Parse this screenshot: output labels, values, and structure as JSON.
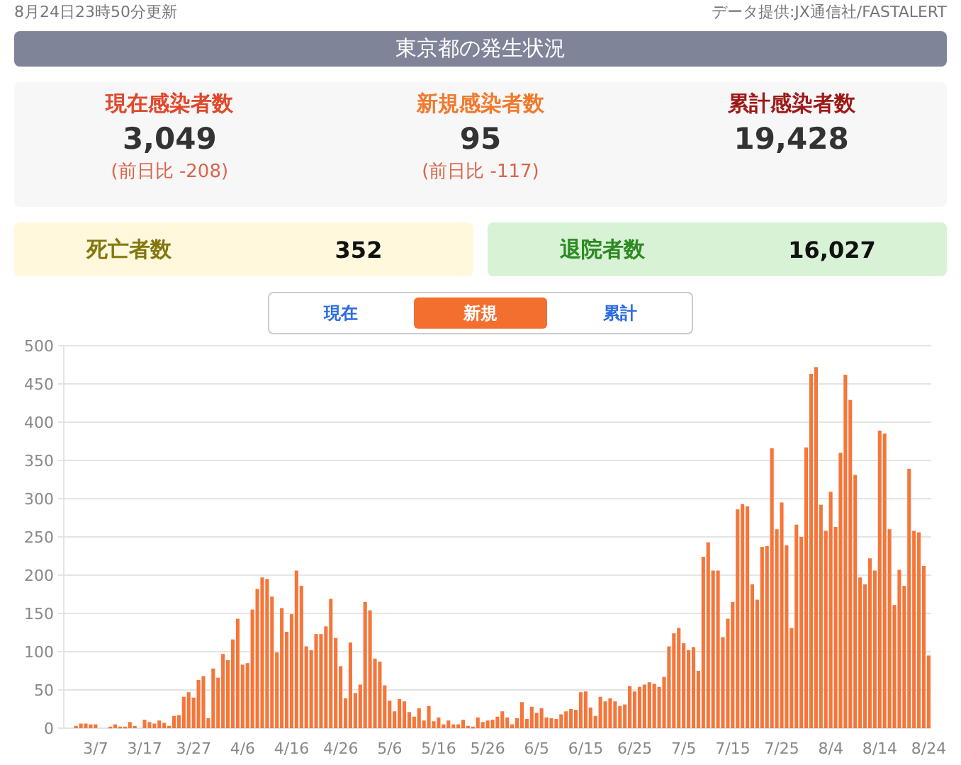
{
  "updated": "8月24日23時50分更新",
  "source": "データ提供:JX通信社/FASTALERT",
  "header": "東京都の発生状況",
  "stats": [
    {
      "label": "現在感染者数",
      "value": "3,049",
      "change": "(前日比 -208)",
      "color": "#e0482c"
    },
    {
      "label": "新規感染者数",
      "value": "95",
      "change": "(前日比 -117)",
      "color": "#f07a2e"
    },
    {
      "label": "累計感染者数",
      "value": "19,428",
      "color": "#9e1a1a"
    }
  ],
  "totals": [
    {
      "kind": "death",
      "label": "死亡者数",
      "value": "352"
    },
    {
      "kind": "recovered",
      "label": "退院者数",
      "value": "16,027"
    }
  ],
  "tabs": [
    {
      "label": "現在",
      "selected": false
    },
    {
      "label": "新規",
      "selected": true
    },
    {
      "label": "累計",
      "selected": false
    }
  ],
  "chart_data": {
    "type": "bar",
    "grid": true,
    "ylim": [
      0,
      500
    ],
    "yticks": [
      0,
      50,
      100,
      150,
      200,
      250,
      300,
      350,
      400,
      450,
      500
    ],
    "categories": [
      null,
      null,
      null,
      null,
      null,
      null,
      "3/7",
      null,
      null,
      null,
      null,
      null,
      null,
      null,
      null,
      null,
      "3/17",
      null,
      null,
      null,
      null,
      null,
      null,
      null,
      null,
      null,
      "3/27",
      null,
      null,
      null,
      null,
      null,
      null,
      null,
      null,
      null,
      "4/6",
      null,
      null,
      null,
      null,
      null,
      null,
      null,
      null,
      null,
      "4/16",
      null,
      null,
      null,
      null,
      null,
      null,
      null,
      null,
      null,
      "4/26",
      null,
      null,
      null,
      null,
      null,
      null,
      null,
      null,
      null,
      "5/6",
      null,
      null,
      null,
      null,
      null,
      null,
      null,
      null,
      null,
      "5/16",
      null,
      null,
      null,
      null,
      null,
      null,
      null,
      null,
      null,
      "5/26",
      null,
      null,
      null,
      null,
      null,
      null,
      null,
      null,
      null,
      "6/5",
      null,
      null,
      null,
      null,
      null,
      null,
      null,
      null,
      null,
      "6/15",
      null,
      null,
      null,
      null,
      null,
      null,
      null,
      null,
      null,
      "6/25",
      null,
      null,
      null,
      null,
      null,
      null,
      null,
      null,
      null,
      "7/5",
      null,
      null,
      null,
      null,
      null,
      null,
      null,
      null,
      null,
      "7/15",
      null,
      null,
      null,
      null,
      null,
      null,
      null,
      null,
      null,
      "7/25",
      null,
      null,
      null,
      null,
      null,
      null,
      null,
      null,
      null,
      "8/4",
      null,
      null,
      null,
      null,
      null,
      null,
      null,
      null,
      null,
      "8/14",
      null,
      null,
      null,
      null,
      null,
      null,
      null,
      null,
      null,
      "8/24"
    ],
    "series": [
      {
        "color": "#f5763a",
        "values": [
          0,
          0,
          3,
          6,
          6,
          5,
          5,
          0,
          0,
          2,
          5,
          2,
          2,
          8,
          3,
          0,
          11,
          8,
          6,
          10,
          7,
          3,
          16,
          17,
          41,
          47,
          40,
          63,
          68,
          13,
          78,
          66,
          97,
          89,
          116,
          143,
          83,
          85,
          155,
          182,
          197,
          195,
          172,
          99,
          157,
          126,
          149,
          206,
          186,
          107,
          102,
          123,
          123,
          133,
          169,
          118,
          81,
          39,
          112,
          46,
          57,
          165,
          154,
          91,
          87,
          56,
          36,
          22,
          38,
          35,
          21,
          15,
          26,
          10,
          29,
          9,
          14,
          5,
          10,
          5,
          5,
          11,
          3,
          2,
          14,
          8,
          10,
          11,
          15,
          22,
          14,
          5,
          13,
          34,
          12,
          28,
          20,
          26,
          14,
          13,
          12,
          18,
          22,
          25,
          24,
          47,
          48,
          27,
          16,
          41,
          35,
          39,
          35,
          29,
          31,
          55,
          48,
          54,
          57,
          60,
          58,
          54,
          67,
          107,
          124,
          131,
          111,
          102,
          106,
          75,
          224,
          243,
          206,
          206,
          119,
          143,
          165,
          286,
          293,
          290,
          188,
          168,
          237,
          238,
          366,
          260,
          295,
          239,
          131,
          266,
          250,
          367,
          463,
          472,
          292,
          258,
          309,
          263,
          360,
          462,
          429,
          331,
          197,
          188,
          222,
          206,
          389,
          385,
          260,
          161,
          207,
          186,
          339,
          258,
          256,
          212,
          95
        ]
      }
    ]
  }
}
